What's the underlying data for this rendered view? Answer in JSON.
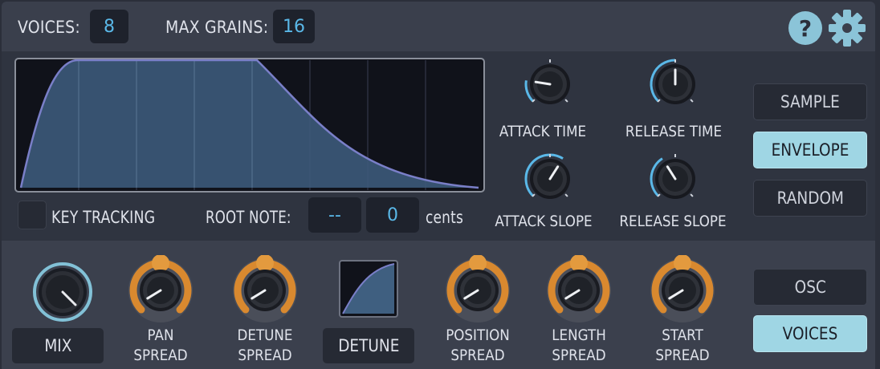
{
  "header": {
    "voices_label": "VOICES:",
    "voices_value": "8",
    "max_grains_label": "MAX GRAINS:",
    "max_grains_value": "16",
    "help_icon": "help-icon",
    "settings_icon": "gear-icon"
  },
  "envelope": {
    "key_tracking_label": "KEY TRACKING",
    "root_note_label": "ROOT NOTE:",
    "root_note_value": "--",
    "cents_value": "0",
    "cents_label": "cents",
    "knobs": [
      {
        "label": "ATTACK TIME",
        "value": 0.2
      },
      {
        "label": "RELEASE TIME",
        "value": 0.5
      },
      {
        "label": "ATTACK SLOPE",
        "value": 0.62
      },
      {
        "label": "RELEASE SLOPE",
        "value": 0.38
      }
    ]
  },
  "modes_top": [
    {
      "label": "SAMPLE",
      "active": false
    },
    {
      "label": "ENVELOPE",
      "active": true
    },
    {
      "label": "RANDOM",
      "active": false
    }
  ],
  "modes_bottom": [
    {
      "label": "OSC",
      "active": false
    },
    {
      "label": "VOICES",
      "active": true
    }
  ],
  "bottom": {
    "mix_label": "MIX",
    "pan_label_1": "PAN",
    "pan_label_2": "SPREAD",
    "detune_spread_1": "DETUNE",
    "detune_spread_2": "SPREAD",
    "detune_label": "DETUNE",
    "position_1": "POSITION",
    "position_2": "SPREAD",
    "length_1": "LENGTH",
    "length_2": "SPREAD",
    "start_1": "START",
    "start_2": "SPREAD"
  },
  "colors": {
    "accent_blue": "#5ab8e8",
    "accent_orange": "#d9892f",
    "active_button": "#9fd6e4"
  }
}
